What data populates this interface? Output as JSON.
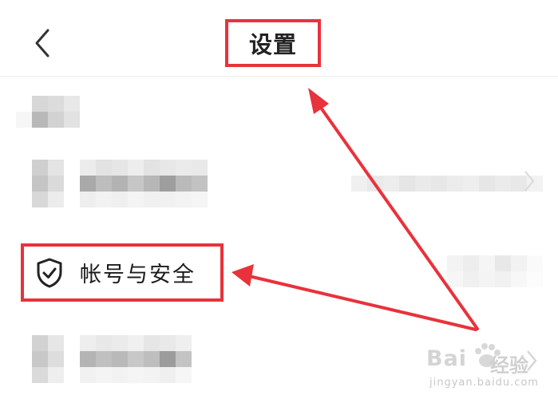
{
  "header": {
    "back_icon": "chevron-left-icon",
    "title": "设置"
  },
  "highlighted_item": {
    "icon": "shield-check-icon",
    "label": "帐号与安全"
  },
  "annotation": {
    "color": "#e8323c"
  },
  "watermark": {
    "brand": "Bai",
    "brand_tail": "经验",
    "url": "jingyan.baidu.com"
  }
}
